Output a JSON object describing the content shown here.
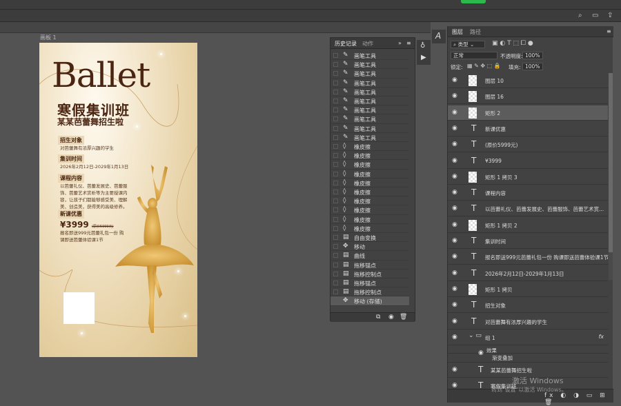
{
  "document": {
    "label": "画板 1"
  },
  "poster": {
    "title": "Ballet",
    "subtitle": "寒假集训班",
    "subtitle2": "某某芭蕾舞招生啦",
    "sections": [
      {
        "heading": "招生对象",
        "text": "对芭蕾舞有浓厚兴趣的学生"
      },
      {
        "heading": "集训时间",
        "text": "2026年2月12日-2029年1月13日"
      },
      {
        "heading": "课程内容",
        "text": "以芭蕾礼仪、芭蕾发展史、芭蕾服饰、芭蕾艺术赏析等为主要授课内容，让孩子们都能够感受美、理解美、创造美，获得美的高级修养。"
      },
      {
        "heading": "新课优惠",
        "text": ""
      }
    ],
    "price": "¥3999",
    "orig_price": "(原价5999元)",
    "promo": "报名即送999元芭蕾礼包一份 购课即送芭蕾体验课1节"
  },
  "history": {
    "tabs": [
      "历史记录",
      "动作"
    ],
    "items": [
      {
        "icon": "brush-icon",
        "label": "画笔工具"
      },
      {
        "icon": "brush-icon",
        "label": "画笔工具"
      },
      {
        "icon": "brush-icon",
        "label": "画笔工具"
      },
      {
        "icon": "brush-icon",
        "label": "画笔工具"
      },
      {
        "icon": "brush-icon",
        "label": "画笔工具"
      },
      {
        "icon": "brush-icon",
        "label": "画笔工具"
      },
      {
        "icon": "brush-icon",
        "label": "画笔工具"
      },
      {
        "icon": "brush-icon",
        "label": "画笔工具"
      },
      {
        "icon": "brush-icon",
        "label": "画笔工具"
      },
      {
        "icon": "brush-icon",
        "label": "画笔工具"
      },
      {
        "icon": "eraser-icon",
        "label": "橡皮擦"
      },
      {
        "icon": "eraser-icon",
        "label": "橡皮擦"
      },
      {
        "icon": "eraser-icon",
        "label": "橡皮擦"
      },
      {
        "icon": "eraser-icon",
        "label": "橡皮擦"
      },
      {
        "icon": "eraser-icon",
        "label": "橡皮擦"
      },
      {
        "icon": "eraser-icon",
        "label": "橡皮擦"
      },
      {
        "icon": "eraser-icon",
        "label": "橡皮擦"
      },
      {
        "icon": "eraser-icon",
        "label": "橡皮擦"
      },
      {
        "icon": "eraser-icon",
        "label": "橡皮擦"
      },
      {
        "icon": "eraser-icon",
        "label": "橡皮擦"
      },
      {
        "icon": "doc-icon",
        "label": "自由变换"
      },
      {
        "icon": "move-icon",
        "label": "移动"
      },
      {
        "icon": "doc-icon",
        "label": "曲线"
      },
      {
        "icon": "doc-icon",
        "label": "拖移锚点"
      },
      {
        "icon": "doc-icon",
        "label": "拖移控制点"
      },
      {
        "icon": "doc-icon",
        "label": "拖移锚点"
      },
      {
        "icon": "doc-icon",
        "label": "拖移控制点"
      },
      {
        "icon": "move-icon",
        "label": "移动 (存储)"
      }
    ]
  },
  "layers": {
    "tabs": [
      "图层",
      "路径"
    ],
    "filter_label": "类型",
    "blend_mode": "正常",
    "opacity_label": "不透明度:",
    "opacity": "100%",
    "lock_label": "锁定:",
    "fill_label": "填充:",
    "fill": "100%",
    "items": [
      {
        "kind": "image",
        "name": "图层 10",
        "fx": ""
      },
      {
        "kind": "image",
        "name": "图层 16",
        "fx": ""
      },
      {
        "kind": "shape",
        "name": "矩形 2",
        "fx": ""
      },
      {
        "kind": "text",
        "name": "新课优惠",
        "fx": ""
      },
      {
        "kind": "text",
        "name": "(原价5999元)",
        "fx": ""
      },
      {
        "kind": "text",
        "name": "¥3999",
        "fx": ""
      },
      {
        "kind": "shape",
        "name": "矩形 1 拷贝 3",
        "fx": ""
      },
      {
        "kind": "text",
        "name": "课程内容",
        "fx": ""
      },
      {
        "kind": "text",
        "name": "以芭蕾礼仪、芭蕾发展史、芭蕾服饰、芭蕾艺术赏...",
        "fx": ""
      },
      {
        "kind": "shape",
        "name": "矩形 1 拷贝 2",
        "fx": ""
      },
      {
        "kind": "text",
        "name": "集训时间",
        "fx": ""
      },
      {
        "kind": "text",
        "name": "报名即送999元芭蕾礼包一份 购课即送芭蕾体验课1节",
        "fx": ""
      },
      {
        "kind": "text",
        "name": "2026年2月12日-2029年1月13日",
        "fx": ""
      },
      {
        "kind": "shape",
        "name": "矩形 1 拷贝",
        "fx": ""
      },
      {
        "kind": "text",
        "name": "招生对象",
        "fx": ""
      },
      {
        "kind": "text",
        "name": "对芭蕾舞有浓厚兴趣的学生",
        "fx": ""
      },
      {
        "kind": "group",
        "name": "组 1",
        "fx": "fx"
      }
    ],
    "effects_label": "效果",
    "effect_item": "渐变叠加",
    "group_children": [
      {
        "kind": "text",
        "name": "某某芭蕾舞招生啦"
      },
      {
        "kind": "text",
        "name": "寒假集训班"
      },
      {
        "kind": "text",
        "name": "Ballet"
      }
    ]
  },
  "watermark": {
    "line1": "激活 Windows",
    "line2": "转到\"设置\"以激活 Windows。"
  },
  "colors": {
    "brown": "#4a2612",
    "gold": "#d9a441",
    "ps_panel": "#424242"
  }
}
